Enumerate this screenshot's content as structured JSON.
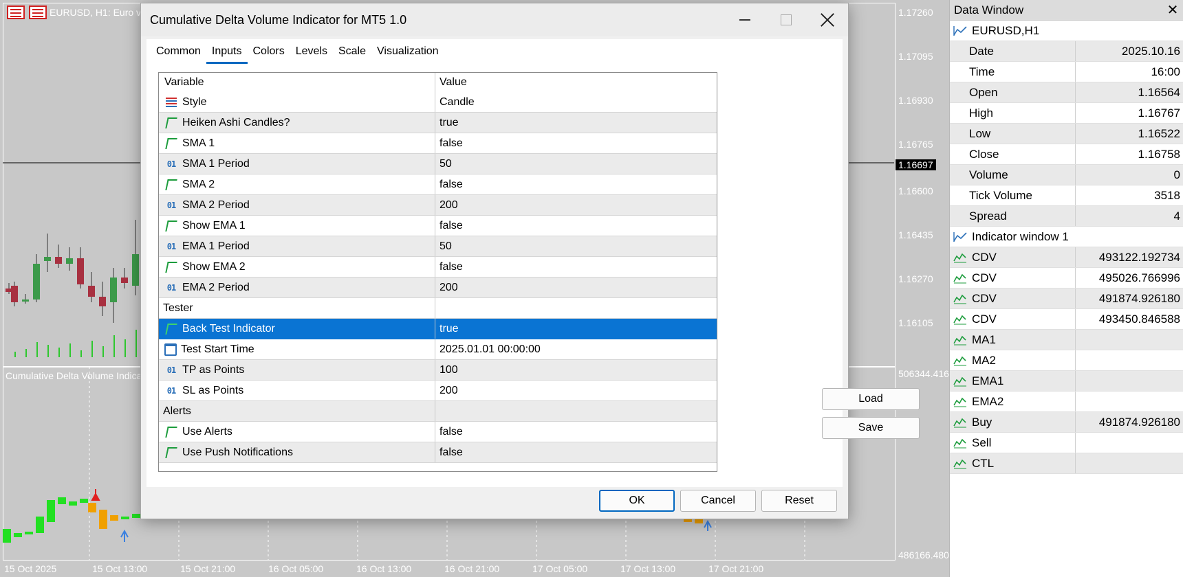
{
  "chart": {
    "title": "EURUSD, H1:  Euro v",
    "subwindow_title": "Cumulative Delta Volume Indicat",
    "price_labels": [
      "1.17260",
      "1.17095",
      "1.16930",
      "1.16765",
      "1.16697",
      "1.16600",
      "1.16435",
      "1.16270",
      "1.16105"
    ],
    "current_price": "1.16697",
    "sub_labels": [
      "506344.416",
      "486166.480"
    ],
    "time_labels": [
      "15 Oct 2025",
      "15 Oct 13:00",
      "15 Oct 21:00",
      "16 Oct 05:00",
      "16 Oct 13:00",
      "16 Oct 21:00",
      "17 Oct 05:00",
      "17 Oct 13:00",
      "17 Oct 21:00"
    ],
    "colors": {
      "bull": "#3c9a4a",
      "bear": "#a83040",
      "volume": "#2ec82e",
      "cdv_up": "#22e022",
      "cdv_down": "#f0a000"
    }
  },
  "dialog": {
    "title": "Cumulative Delta Volume Indicator for MT5 1.0",
    "tabs": [
      {
        "label": "Common"
      },
      {
        "label": "Inputs",
        "active": true
      },
      {
        "label": "Colors"
      },
      {
        "label": "Levels"
      },
      {
        "label": "Scale"
      },
      {
        "label": "Visualization"
      }
    ],
    "columns": {
      "variable": "Variable",
      "value": "Value"
    },
    "rows": [
      {
        "name": "Style",
        "value": "Candle",
        "icon": "style-icon"
      },
      {
        "name": "Heiken Ashi Candles?",
        "value": "true",
        "icon": "bool-icon"
      },
      {
        "name": "SMA 1",
        "value": "false",
        "icon": "bool-icon"
      },
      {
        "name": "SMA 1 Period",
        "value": "50",
        "icon": "int-icon"
      },
      {
        "name": "SMA 2",
        "value": "false",
        "icon": "bool-icon"
      },
      {
        "name": "SMA 2 Period",
        "value": "200",
        "icon": "int-icon"
      },
      {
        "name": "Show EMA 1",
        "value": "false",
        "icon": "bool-icon"
      },
      {
        "name": "EMA 1 Period",
        "value": "50",
        "icon": "int-icon"
      },
      {
        "name": "Show EMA 2",
        "value": "false",
        "icon": "bool-icon"
      },
      {
        "name": "EMA 2 Period",
        "value": "200",
        "icon": "int-icon"
      },
      {
        "name": "Tester",
        "value": "",
        "icon": "group"
      },
      {
        "name": "Back Test Indicator",
        "value": "true",
        "icon": "bool-icon",
        "selected": true
      },
      {
        "name": "Test Start Time",
        "value": "2025.01.01 00:00:00",
        "icon": "calendar-icon"
      },
      {
        "name": "TP as Points",
        "value": "100",
        "icon": "int-icon"
      },
      {
        "name": "SL as Points",
        "value": "200",
        "icon": "int-icon"
      },
      {
        "name": "Alerts",
        "value": "",
        "icon": "group"
      },
      {
        "name": "Use Alerts",
        "value": "false",
        "icon": "bool-icon"
      },
      {
        "name": "Use Push Notifications",
        "value": "false",
        "icon": "bool-icon"
      }
    ],
    "buttons": {
      "load": "Load",
      "save": "Save",
      "ok": "OK",
      "cancel": "Cancel",
      "reset": "Reset"
    },
    "int_icon_glyph": "01"
  },
  "data_window": {
    "title": "Data Window",
    "close_glyph": "✕",
    "symbol_group": "EURUSD,H1",
    "symbol_rows": [
      {
        "key": "Date",
        "value": "2025.10.16"
      },
      {
        "key": "Time",
        "value": "16:00"
      },
      {
        "key": "Open",
        "value": "1.16564"
      },
      {
        "key": "High",
        "value": "1.16767"
      },
      {
        "key": "Low",
        "value": "1.16522"
      },
      {
        "key": "Close",
        "value": "1.16758"
      },
      {
        "key": "Volume",
        "value": "0"
      },
      {
        "key": "Tick Volume",
        "value": "3518"
      },
      {
        "key": "Spread",
        "value": "4"
      }
    ],
    "indicator_group": "Indicator window 1",
    "indicator_rows": [
      {
        "key": "CDV",
        "value": "493122.192734"
      },
      {
        "key": "CDV",
        "value": "495026.766996"
      },
      {
        "key": "CDV",
        "value": "491874.926180"
      },
      {
        "key": "CDV",
        "value": "493450.846588"
      },
      {
        "key": "MA1",
        "value": ""
      },
      {
        "key": "MA2",
        "value": ""
      },
      {
        "key": "EMA1",
        "value": ""
      },
      {
        "key": "EMA2",
        "value": ""
      },
      {
        "key": "Buy",
        "value": "491874.926180"
      },
      {
        "key": "Sell",
        "value": ""
      },
      {
        "key": "CTL",
        "value": ""
      }
    ]
  }
}
